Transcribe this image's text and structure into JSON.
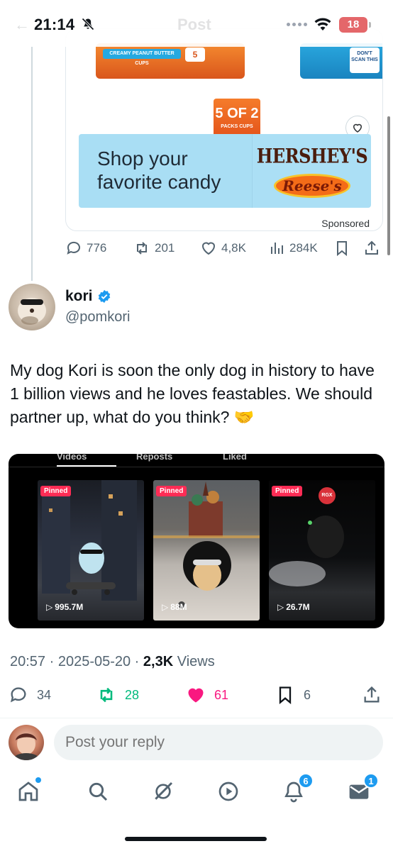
{
  "status_bar": {
    "time": "21:14",
    "battery": "18",
    "faded_title": "Post"
  },
  "ad": {
    "bar_label": "CREAMY PEANUT BUTTER CUPS",
    "bar_pack": "5",
    "scan_label": "DON'T SCAN THIS",
    "pack_number": "5 OF 2",
    "pack_label": "PACKS   CUPS",
    "banner_text": "Shop your favorite candy",
    "brand_top": "HERSHEY'S",
    "brand_bottom": "Reese's",
    "sponsored": "Sponsored",
    "stats": {
      "replies": "776",
      "reposts": "201",
      "likes": "4,8K",
      "views": "284K"
    }
  },
  "post": {
    "author_name": "kori",
    "author_handle": "@pomkori",
    "text": "My dog Kori is soon the only dog in history to have 1 billion views and he loves feastables. We should partner up, what do you think? 🤝",
    "timestamp": "20:57 · 2025-05-20 · ",
    "views_count": "2,3K",
    "views_label": " Views",
    "replies": "34",
    "reposts": "28",
    "likes": "61",
    "bookmarks": "6"
  },
  "media": {
    "tabs": [
      "Videos",
      "Reposts",
      "Liked"
    ],
    "thumbs": [
      {
        "pinned": "Pinned",
        "views": "995.7M"
      },
      {
        "pinned": "Pinned",
        "views": "88M"
      },
      {
        "pinned": "Pinned",
        "views": "26.7M"
      }
    ],
    "rgx": "RGX"
  },
  "reply": {
    "placeholder": "Post your reply"
  },
  "nav": {
    "notifications_badge": "6",
    "messages_badge": "1"
  },
  "colors": {
    "accent": "#1d9bf0",
    "repost_green": "#00ba7c",
    "like_pink": "#f91880",
    "secondary_text": "#536471"
  }
}
